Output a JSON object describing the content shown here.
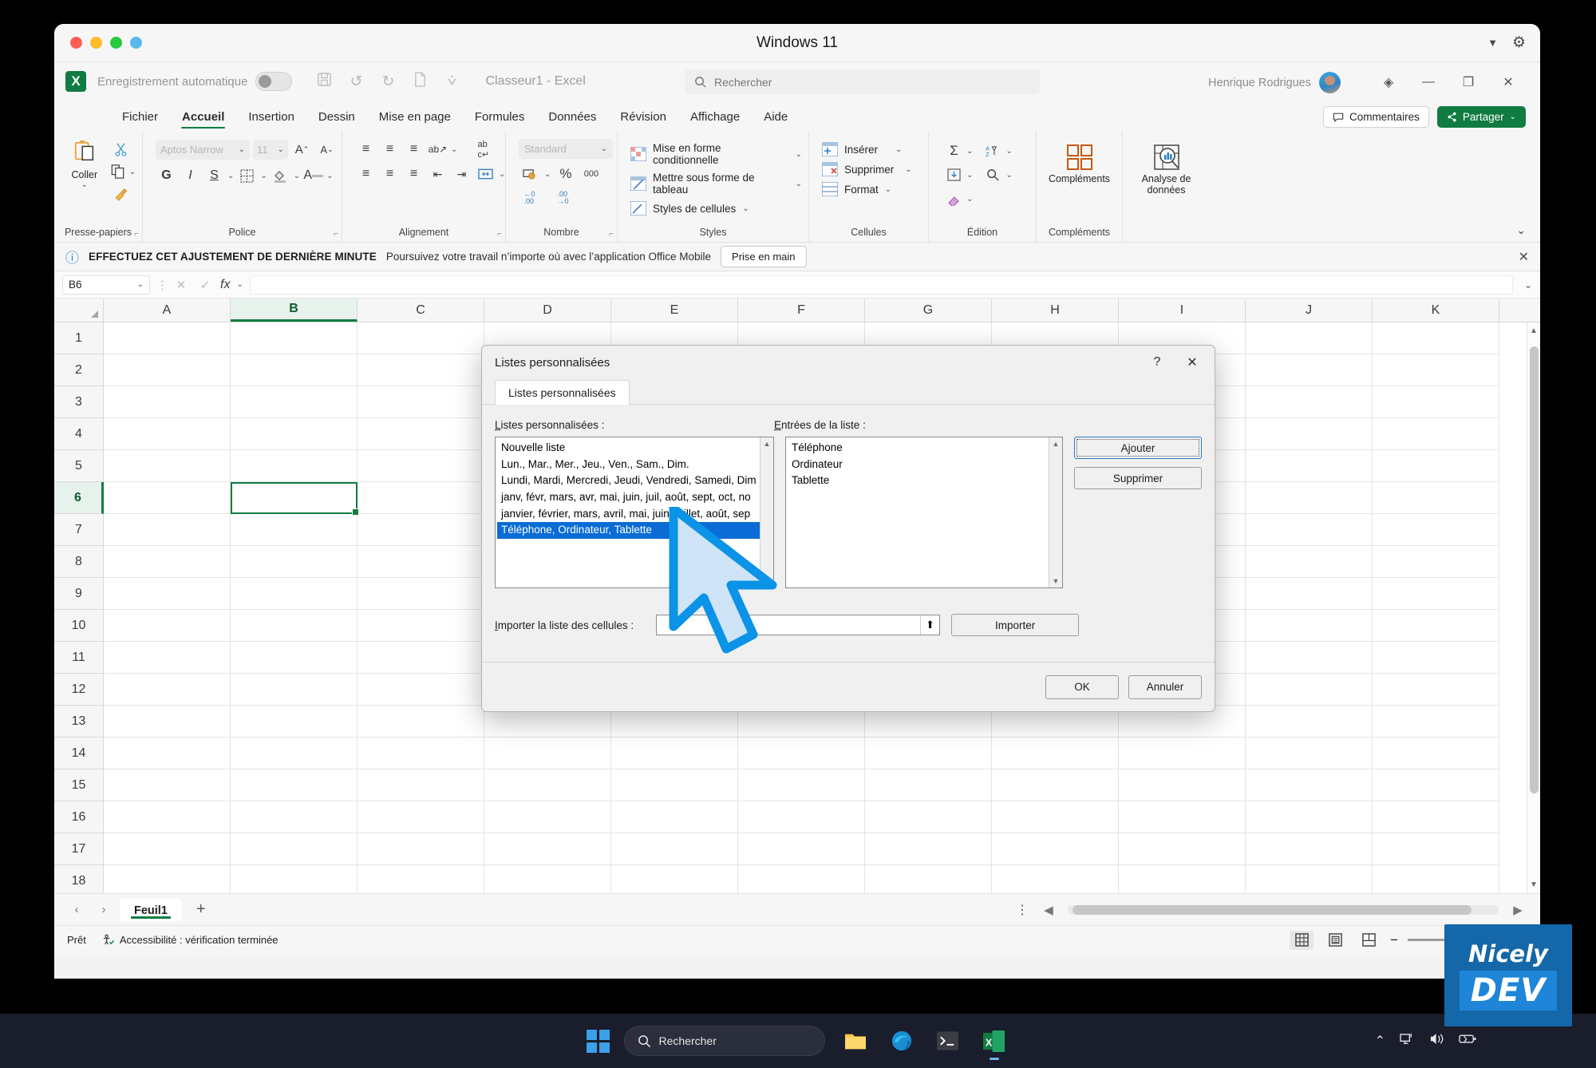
{
  "window": {
    "title": "Windows 11",
    "traffic_lights": [
      "red",
      "yellow",
      "green",
      "blue"
    ],
    "collapse_icon": "▼",
    "settings_icon": "gear-icon"
  },
  "qat": {
    "app_logo": "X",
    "autosave_label": "Enregistrement automatique",
    "save_icon": "💾",
    "undo_icon": "↺",
    "redo_icon": "↻",
    "new_icon": "🗎",
    "more_icon": "⩒",
    "document_title": "Classeur1  -  Excel",
    "search_placeholder": "Rechercher",
    "user_name": "Henrique Rodrigues",
    "diamond_icon": "◈",
    "minimize": "—",
    "maximize": "❐",
    "close": "✕"
  },
  "ribbon": {
    "tabs": [
      {
        "label": "Fichier",
        "active": false
      },
      {
        "label": "Accueil",
        "active": true
      },
      {
        "label": "Insertion",
        "active": false
      },
      {
        "label": "Dessin",
        "active": false
      },
      {
        "label": "Mise en page",
        "active": false
      },
      {
        "label": "Formules",
        "active": false
      },
      {
        "label": "Données",
        "active": false
      },
      {
        "label": "Révision",
        "active": false
      },
      {
        "label": "Affichage",
        "active": false
      },
      {
        "label": "Aide",
        "active": false
      }
    ],
    "comments_label": "Commentaires",
    "share_label": "Partager",
    "collapse_chevron": "⌄",
    "groups": {
      "clipboard": {
        "label": "Presse-papiers",
        "paste_label": "Coller",
        "cut_icon": "✂",
        "copy_icon": "⧉",
        "format_painter_icon": "🖌"
      },
      "font": {
        "label": "Police",
        "font_name": "Aptos Narrow",
        "font_size": "11",
        "grow_icon": "A⌃",
        "shrink_icon": "A⌄",
        "bold": "G",
        "italic": "I",
        "underline": "S",
        "borders_icon": "⊞",
        "fill_icon": "🖍",
        "color_icon": "A"
      },
      "alignment": {
        "label": "Alignement",
        "top_icon": "≡",
        "middle_icon": "≡",
        "bottom_icon": "≡",
        "orientation_icon": "ab↗",
        "wrap_icon": "ab↵",
        "left_icon": "≡",
        "center_icon": "≡",
        "right_icon": "≡",
        "decrease_indent_icon": "⇤",
        "increase_indent_icon": "⇥",
        "merge_icon": "⬌"
      },
      "number": {
        "label": "Nombre",
        "format": "Standard",
        "currency_icon": "💱",
        "percent_icon": "%",
        "thousands_icon": "000",
        "increase_decimal_icon": "←.0",
        "decrease_decimal_icon": ".00→"
      },
      "styles": {
        "label": "Styles",
        "items": [
          "Mise en forme conditionnelle",
          "Mettre sous forme de tableau",
          "Styles de cellules"
        ]
      },
      "cells": {
        "label": "Cellules",
        "items": [
          "Insérer",
          "Supprimer",
          "Format"
        ]
      },
      "editing": {
        "label": "Édition",
        "sum_icon": "Σ",
        "fill_icon": "⬇",
        "clear_icon": "◇",
        "sort_icon": "A↓Y",
        "find_icon": "🔍"
      },
      "addins": {
        "label": "Compléments",
        "button_label": "Compléments"
      },
      "analysis": {
        "label": "",
        "button_label": "Analyse de données"
      }
    }
  },
  "notification": {
    "info_icon": "ⓘ",
    "headline": "EFFECTUEZ CET AJUSTEMENT DE DERNIÈRE MINUTE",
    "body": "Poursuivez votre travail n’importe où avec l’application Office Mobile",
    "button_label": "Prise en main",
    "close_icon": "✕"
  },
  "formula_bar": {
    "name_box": "B6",
    "name_box_caret": "⌄",
    "kebab": "⋮",
    "cancel_icon": "✕",
    "confirm_icon": "✓",
    "fx_icon": "fx",
    "value": "",
    "expand_caret": "⌄"
  },
  "grid": {
    "columns": [
      "A",
      "B",
      "C",
      "D",
      "E",
      "F",
      "G",
      "H",
      "I",
      "J",
      "K"
    ],
    "selected_column": "B",
    "rows": [
      "1",
      "2",
      "3",
      "4",
      "5",
      "6",
      "7",
      "8",
      "9",
      "10",
      "11",
      "12",
      "13",
      "14",
      "15",
      "16",
      "17",
      "18"
    ],
    "selected_row": "6",
    "active_cell": "B6"
  },
  "sheet_tabs": {
    "prev_icon": "‹",
    "next_icon": "›",
    "sheets": [
      "Feuil1"
    ],
    "add_icon": "+",
    "menu_icon": "⋮"
  },
  "status_bar": {
    "ready": "Prêt",
    "accessibility": "Accessibilité : vérification terminée",
    "view_normal_icon": "▦",
    "view_layout_icon": "▤",
    "view_pagebreak_icon": "⊞",
    "zoom_out": "−",
    "zoom_in": "+"
  },
  "dialog": {
    "title": "Listes personnalisées",
    "help_icon": "?",
    "close_icon": "✕",
    "tab_label": "Listes personnalisées",
    "lists_label": "Listes personnalisées :",
    "entries_label": "Entrées de la liste :",
    "custom_lists": [
      {
        "text": "Nouvelle liste",
        "selected": false
      },
      {
        "text": "Lun., Mar., Mer., Jeu., Ven., Sam., Dim.",
        "selected": false
      },
      {
        "text": "Lundi, Mardi, Mercredi, Jeudi, Vendredi, Samedi, Dim",
        "selected": false
      },
      {
        "text": "janv, févr, mars, avr, mai, juin, juil, août, sept, oct, no",
        "selected": false
      },
      {
        "text": "janvier, février, mars, avril, mai, juin, juillet, août, sep",
        "selected": false
      },
      {
        "text": "Téléphone, Ordinateur, Tablette",
        "selected": true
      }
    ],
    "list_entries": [
      "Téléphone",
      "Ordinateur",
      "Tablette"
    ],
    "add_label": "Ajouter",
    "delete_label": "Supprimer",
    "import_label": "Importer la liste des cellules :",
    "import_field_value": "",
    "import_button_label": "Importer",
    "range_picker_icon": "⬆",
    "ok_label": "OK",
    "cancel_label": "Annuler",
    "scroll_up_icon": "▲",
    "scroll_down_icon": "▼",
    "selection_color": "#0a6cd4"
  },
  "taskbar": {
    "start_icon": "windows-logo-icon",
    "search_placeholder": "Rechercher",
    "apps": [
      "file-explorer-icon",
      "edge-icon",
      "terminal-icon",
      "excel-icon"
    ],
    "tray": {
      "chevron_up": "⌃",
      "network_icon": "🖧",
      "volume_icon": "🔊",
      "battery_icon": "🔋"
    }
  },
  "brand": {
    "line1": "Nicely",
    "line2": "DEV"
  },
  "colors": {
    "excel_green": "#107c41",
    "selection_blue": "#0a6cd4",
    "brand_blue": "#1467a8"
  }
}
